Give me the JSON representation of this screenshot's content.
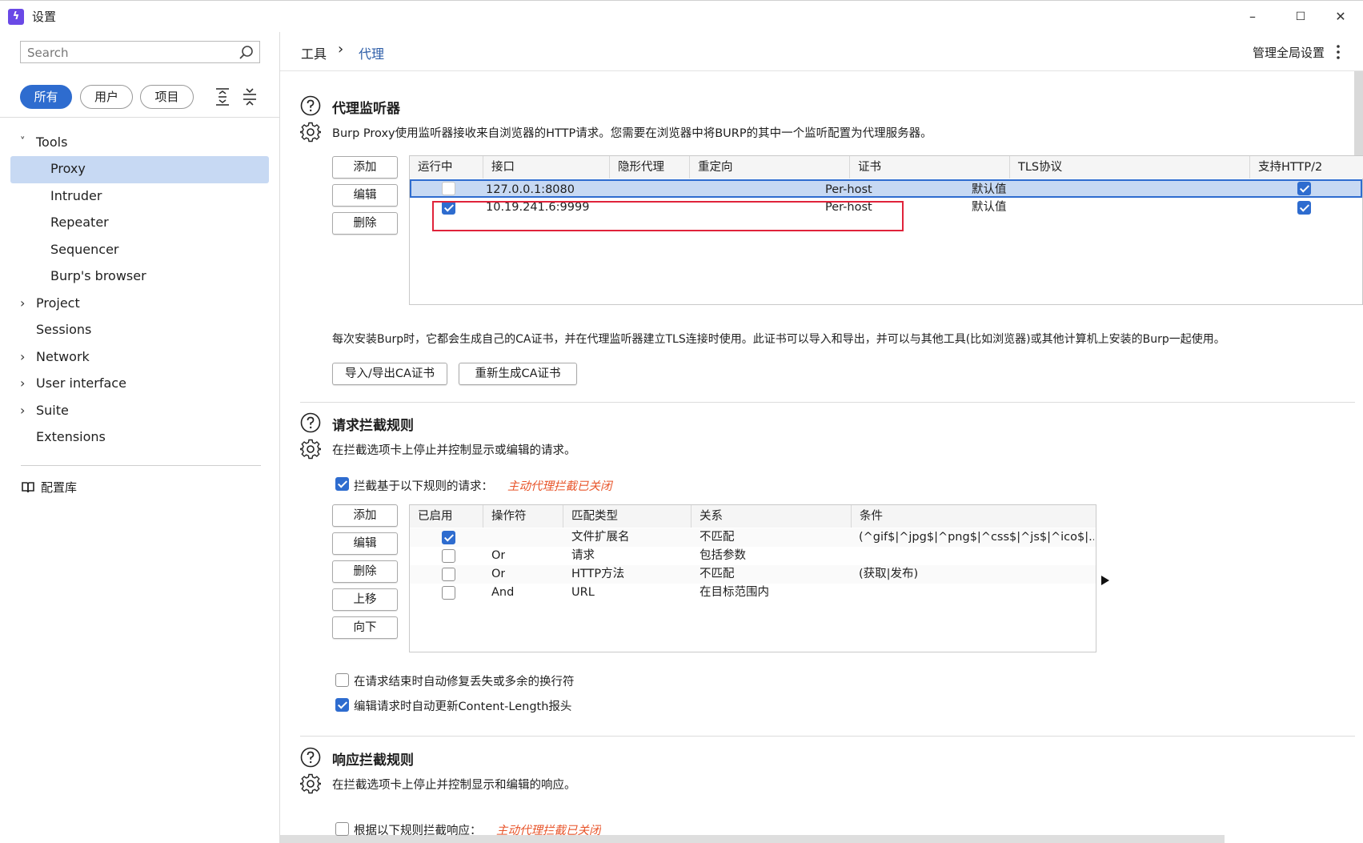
{
  "window": {
    "title": "设置",
    "minimize": "–",
    "maximize": "☐",
    "close": "✕"
  },
  "sidebar": {
    "search_placeholder": "Search",
    "filters": [
      "所有",
      "用户",
      "项目"
    ],
    "nav": [
      {
        "label": "Tools",
        "expandable": "˅"
      },
      {
        "label": "Proxy"
      },
      {
        "label": "Intruder"
      },
      {
        "label": "Repeater"
      },
      {
        "label": "Sequencer"
      },
      {
        "label": "Burp's browser"
      },
      {
        "label": "Project",
        "expandable": "›"
      },
      {
        "label": "Sessions"
      },
      {
        "label": "Network",
        "expandable": "›"
      },
      {
        "label": "User interface",
        "expandable": "›"
      },
      {
        "label": "Suite",
        "expandable": "›"
      },
      {
        "label": "Extensions"
      }
    ],
    "library": "配置库"
  },
  "breadcrumb": {
    "parent": "工具",
    "sep": "›",
    "current": "代理"
  },
  "global_settings": "管理全局设置",
  "listeners": {
    "title": "代理监听器",
    "desc": "Burp Proxy使用监听器接收来自浏览器的HTTP请求。您需要在浏览器中将BURP的其中一个监听配置为代理服务器。",
    "buttons": [
      "添加",
      "编辑",
      "删除"
    ],
    "columns": [
      "运行中",
      "接口",
      "隐形代理",
      "重定向",
      "证书",
      "TLS协议",
      "支持HTTP/2"
    ],
    "rows": [
      {
        "interface": "127.0.0.1:8080",
        "cert": "Per-host",
        "tls": "默认值"
      },
      {
        "interface": "10.19.241.6:9999",
        "cert": "Per-host",
        "tls": "默认值"
      }
    ],
    "ca_desc": "每次安装Burp时，它都会生成自己的CA证书，并在代理监听器建立TLS连接时使用。此证书可以导入和导出，并可以与其他工具(比如浏览器)或其他计算机上安装的Burp一起使用。",
    "ca_buttons": [
      "导入/导出CA证书",
      "重新生成CA证书"
    ]
  },
  "request_rules": {
    "title": "请求拦截规则",
    "desc": "在拦截选项卡上停止并控制显示或编辑的请求。",
    "intercept_label": "拦截基于以下规则的请求：",
    "intercept_warn": "主动代理拦截已关闭",
    "buttons": [
      "添加",
      "编辑",
      "删除",
      "上移",
      "向下"
    ],
    "columns": [
      "已启用",
      "操作符",
      "匹配类型",
      "关系",
      "条件"
    ],
    "rows": [
      {
        "op": "",
        "type": "文件扩展名",
        "rel": "不匹配",
        "cond": "(^gif$|^jpg$|^png$|^css$|^js$|^ico$|..."
      },
      {
        "op": "Or",
        "type": "请求",
        "rel": "包括参数",
        "cond": ""
      },
      {
        "op": "Or",
        "type": "HTTP方法",
        "rel": "不匹配",
        "cond": "(获取|发布)"
      },
      {
        "op": "And",
        "type": "URL",
        "rel": "在目标范围内",
        "cond": ""
      }
    ],
    "opt1": "在请求结束时自动修复丢失或多余的换行符",
    "opt2": "编辑请求时自动更新Content-Length报头"
  },
  "response_rules": {
    "title": "响应拦截规则",
    "desc": "在拦截选项卡上停止并控制显示和编辑的响应。",
    "intercept_label": "根据以下规则拦截响应：",
    "intercept_warn": "主动代理拦截已关闭"
  },
  "colors": {
    "accent": "#2e6ccf",
    "highlight": "#e0233a",
    "warn": "#e8552b",
    "selected_row": "#c7d9f3"
  }
}
